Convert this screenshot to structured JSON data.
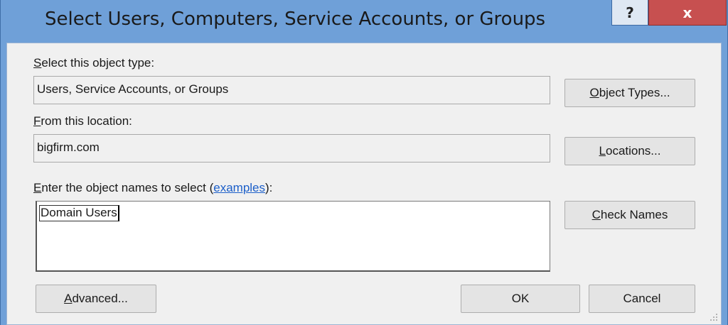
{
  "window": {
    "title": "Select Users, Computers, Service Accounts, or Groups",
    "help_label": "?",
    "close_label": "x"
  },
  "object_type": {
    "label_access": "S",
    "label_rest": "elect this object type:",
    "value": "Users, Service Accounts, or Groups",
    "button_access": "O",
    "button_rest": "bject Types..."
  },
  "location": {
    "label_access": "F",
    "label_rest": "rom this location:",
    "value": "bigfirm.com",
    "button_access": "L",
    "button_rest": "ocations..."
  },
  "names": {
    "label_access": "E",
    "label_rest": "nter the object names to select (",
    "link": "examples",
    "label_end": "):",
    "value": "Domain Users",
    "button_access": "C",
    "button_rest": "heck Names"
  },
  "footer": {
    "advanced_access": "A",
    "advanced_rest": "dvanced...",
    "ok_label": "OK",
    "cancel_label": "Cancel"
  },
  "colors": {
    "titlebar": "#6fa0d8",
    "close": "#c75050",
    "client": "#f0f0f0",
    "link": "#1c5fc9"
  }
}
